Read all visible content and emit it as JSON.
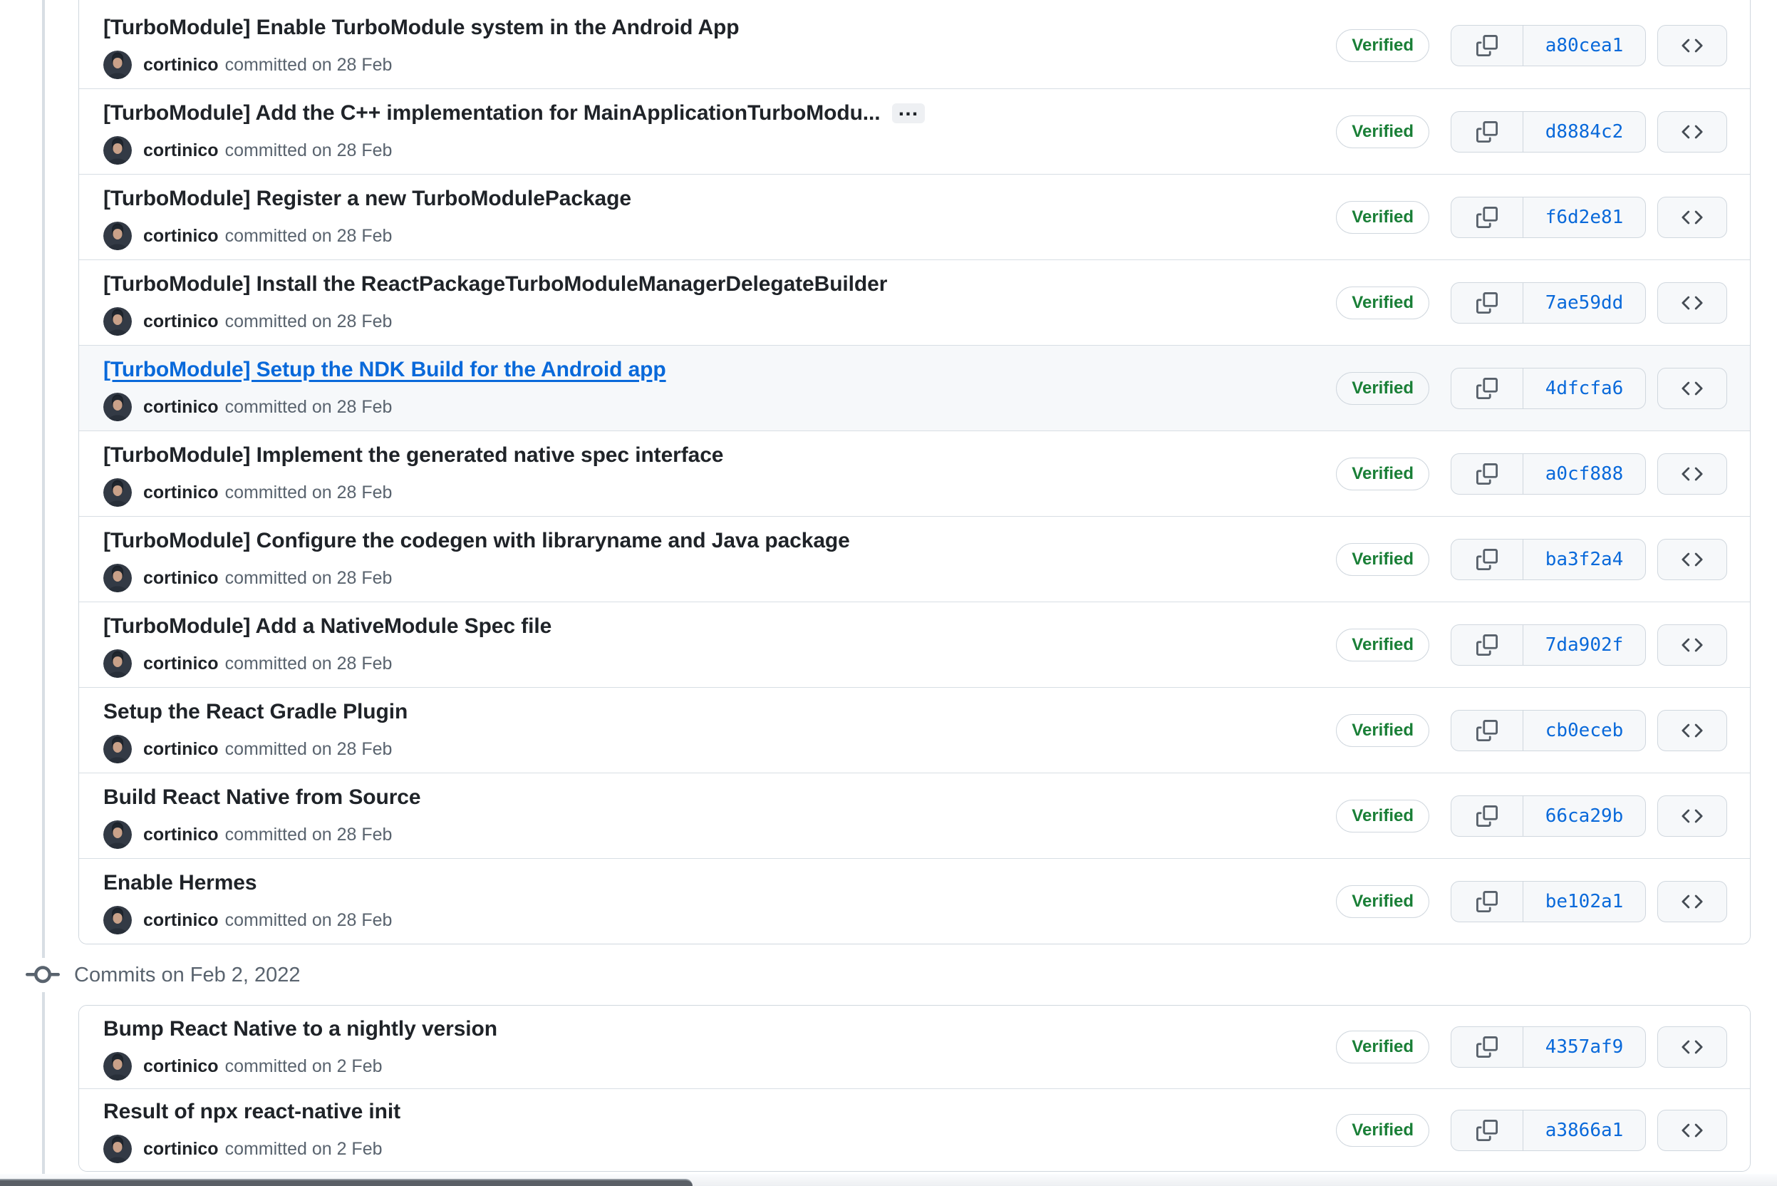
{
  "badge_label": "Verified",
  "author_name": "cortinico",
  "glyphs": {
    "ellipsis": "…"
  },
  "colors": {
    "accent": "#0969da",
    "success_text": "#1a7f37",
    "title_text": "#1f2328",
    "muted_text": "#59636e",
    "border": "#d0d7de",
    "hover_row_bg": "#f6f8fa",
    "timeline_line": "#d8dee4",
    "bottom_bar": "#5a5f66"
  },
  "sections": [
    {
      "heading": "",
      "commits": [
        {
          "title": "[TurboModule] Enable TurboModule system in the Android App",
          "author": "cortinico",
          "meta": "committed on 28 Feb",
          "badge": "Verified",
          "sha": "a80cea1",
          "hovered": false,
          "truncated": false
        },
        {
          "title": "[TurboModule] Add the C++ implementation for MainApplicationTurboModu...",
          "author": "cortinico",
          "meta": "committed on 28 Feb",
          "badge": "Verified",
          "sha": "d8884c2",
          "hovered": false,
          "truncated": true
        },
        {
          "title": "[TurboModule] Register a new TurboModulePackage",
          "author": "cortinico",
          "meta": "committed on 28 Feb",
          "badge": "Verified",
          "sha": "f6d2e81",
          "hovered": false,
          "truncated": false
        },
        {
          "title": "[TurboModule] Install the ReactPackageTurboModuleManagerDelegateBuilder",
          "author": "cortinico",
          "meta": "committed on 28 Feb",
          "badge": "Verified",
          "sha": "7ae59dd",
          "hovered": false,
          "truncated": false
        },
        {
          "title": "[TurboModule] Setup the NDK Build for the Android app",
          "author": "cortinico",
          "meta": "committed on 28 Feb",
          "badge": "Verified",
          "sha": "4dfcfa6",
          "hovered": true,
          "truncated": false
        },
        {
          "title": "[TurboModule] Implement the generated native spec interface",
          "author": "cortinico",
          "meta": "committed on 28 Feb",
          "badge": "Verified",
          "sha": "a0cf888",
          "hovered": false,
          "truncated": false
        },
        {
          "title": "[TurboModule] Configure the codegen with libraryname and Java package",
          "author": "cortinico",
          "meta": "committed on 28 Feb",
          "badge": "Verified",
          "sha": "ba3f2a4",
          "hovered": false,
          "truncated": false
        },
        {
          "title": "[TurboModule] Add a NativeModule Spec file",
          "author": "cortinico",
          "meta": "committed on 28 Feb",
          "badge": "Verified",
          "sha": "7da902f",
          "hovered": false,
          "truncated": false
        },
        {
          "title": "Setup the React Gradle Plugin",
          "author": "cortinico",
          "meta": "committed on 28 Feb",
          "badge": "Verified",
          "sha": "cb0eceb",
          "hovered": false,
          "truncated": false
        },
        {
          "title": "Build React Native from Source",
          "author": "cortinico",
          "meta": "committed on 28 Feb",
          "badge": "Verified",
          "sha": "66ca29b",
          "hovered": false,
          "truncated": false
        },
        {
          "title": "Enable Hermes",
          "author": "cortinico",
          "meta": "committed on 28 Feb",
          "badge": "Verified",
          "sha": "be102a1",
          "hovered": false,
          "truncated": false
        }
      ]
    },
    {
      "heading": "Commits on Feb 2, 2022",
      "commits": [
        {
          "title": "Bump React Native to a nightly version",
          "author": "cortinico",
          "meta": "committed on 2 Feb",
          "badge": "Verified",
          "sha": "4357af9",
          "hovered": false,
          "truncated": false
        },
        {
          "title": "Result of npx react-native init",
          "author": "cortinico",
          "meta": "committed on 2 Feb",
          "badge": "Verified",
          "sha": "a3866a1",
          "hovered": false,
          "truncated": false
        }
      ]
    }
  ]
}
